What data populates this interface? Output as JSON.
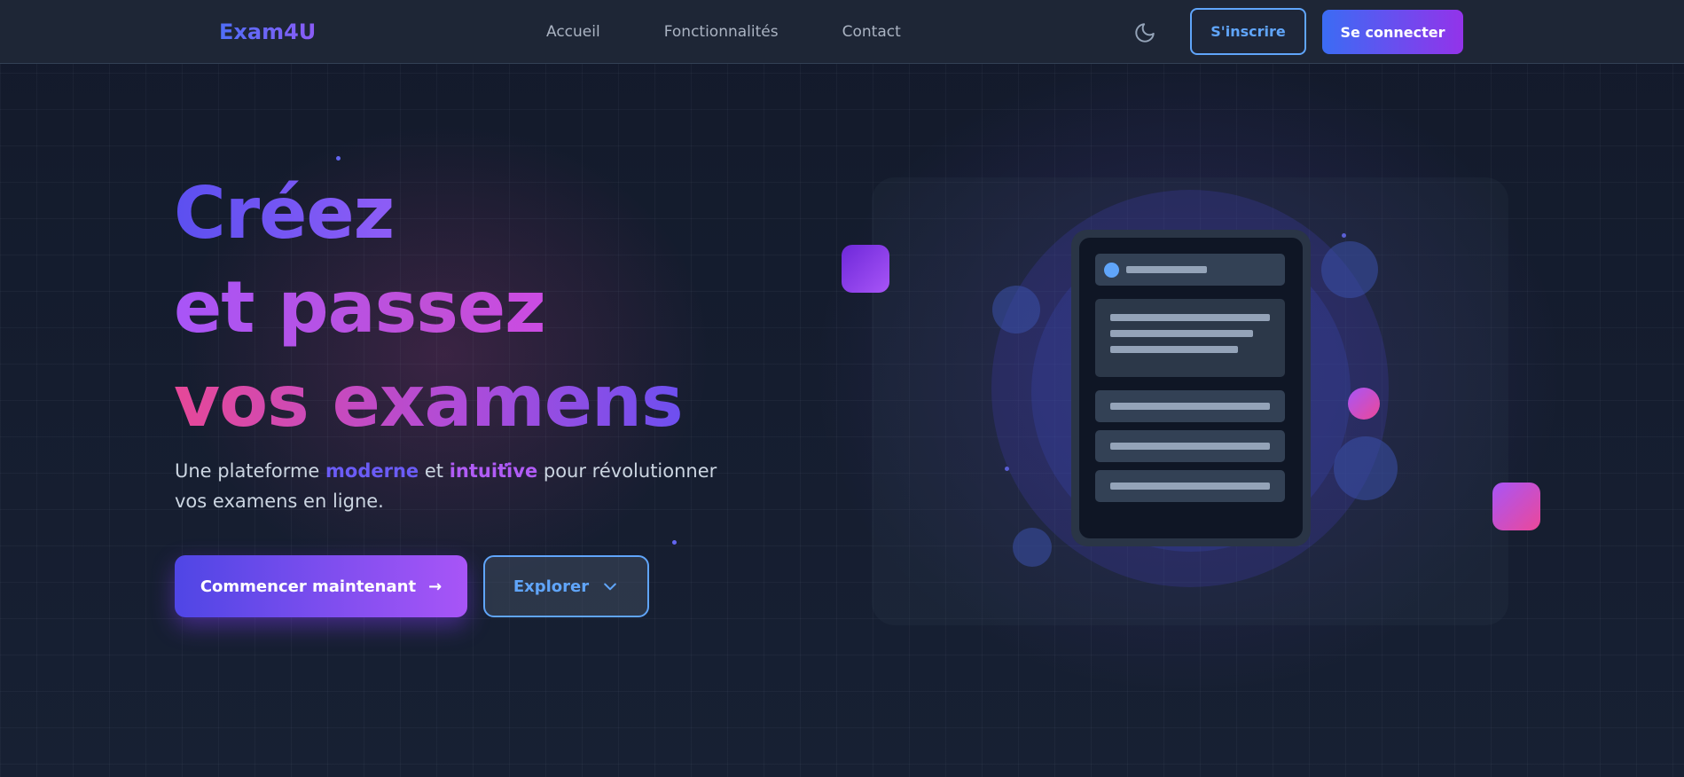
{
  "header": {
    "logo": "Exam4U",
    "nav": [
      "Accueil",
      "Fonctionnalités",
      "Contact"
    ],
    "signup_label": "S'inscrire",
    "login_label": "Se connecter",
    "theme_icon": "moon-icon"
  },
  "hero": {
    "title_lines": [
      "Créez",
      "et passez",
      "vos examens"
    ],
    "subtitle": {
      "before": "Une plateforme ",
      "highlight1": "moderne",
      "middle": " et ",
      "highlight2": "intuitive",
      "after": " pour révolutionner vos examens en ligne."
    },
    "primary_button": "Commencer maintenant",
    "secondary_button": "Explorer"
  },
  "colors": {
    "accent_blue": "#3b6cf4",
    "accent_purple": "#9333ea",
    "accent_pink": "#ec4899",
    "outline_blue": "#60a5fa"
  }
}
